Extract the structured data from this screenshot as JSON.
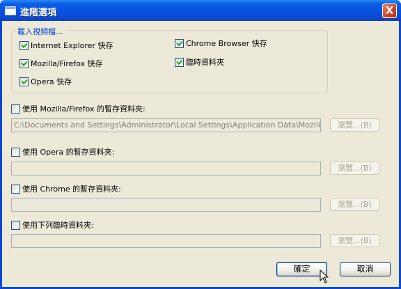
{
  "window": {
    "title": "進階選項",
    "close_glyph": "X"
  },
  "group": {
    "label": "載入視頻檔...",
    "items": [
      {
        "label": "Internet Explorer 快存",
        "checked": true
      },
      {
        "label": "Mozilla/Firefox 快存",
        "checked": true
      },
      {
        "label": "Opera 快存",
        "checked": true
      },
      {
        "label": "Chrome Browser 快存",
        "checked": true
      },
      {
        "label": "臨時資料夾",
        "checked": true
      }
    ]
  },
  "sections": [
    {
      "checkbox": "使用 Mozilla/Firefox 的暫存資料夾:",
      "checked": false,
      "path": "C:\\Documents and Settings\\Administrator\\Local Settings\\Application Data\\Mozilla\\Firefox\\Pro",
      "browse": "瀏覽...(B)"
    },
    {
      "checkbox": "使用 Opera 的暫存資料夾:",
      "checked": false,
      "path": "",
      "browse": "瀏覽...(B)"
    },
    {
      "checkbox": "使用 Chrome 的暫存資料夾:",
      "checked": false,
      "path": "",
      "browse": "瀏覽...(B)"
    },
    {
      "checkbox": "使用下列臨時資料夾:",
      "checked": false,
      "path": "",
      "browse": "瀏覽...(B)"
    }
  ],
  "buttons": {
    "ok": "確定",
    "cancel": "取消"
  }
}
